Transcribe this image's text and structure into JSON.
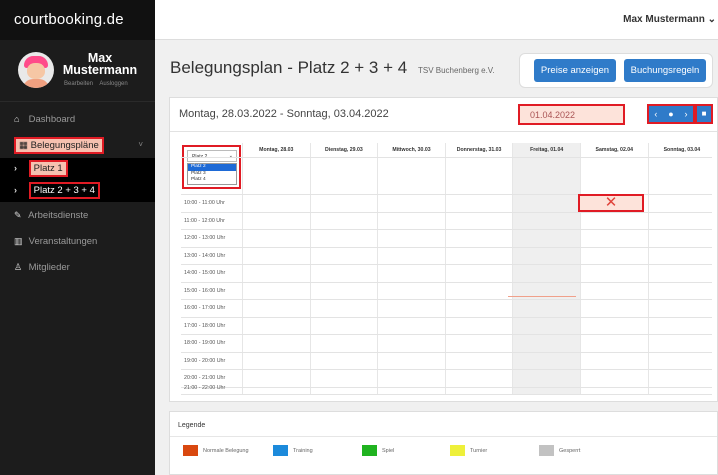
{
  "brand": "courtbooking.de",
  "profile": {
    "name": "Max Mustermann",
    "edit": "Bearbeiten",
    "logout": "Ausloggen"
  },
  "menu": {
    "dashboard": "Dashboard",
    "plans": "Belegungspläne",
    "platz1": "Platz 1",
    "platz234": "Platz 2 + 3 + 4",
    "arbeitsdienste": "Arbeitsdienste",
    "veranstaltungen": "Veranstaltungen",
    "mitglieder": "Mitglieder"
  },
  "user_menu": "Max Mustermann ⌄",
  "page": {
    "title": "Belegungsplan - Platz 2 + 3 + 4",
    "club": "TSV Buchenberg e.V."
  },
  "buttons": {
    "prices": "Preise anzeigen",
    "rules": "Buchungsregeln"
  },
  "week": {
    "range": "Montag, 28.03.2022 - Sonntag, 03.04.2022",
    "date_input": "01.04.2022"
  },
  "court_select": {
    "value": "Platz 2",
    "options": [
      "Platz 2",
      "Platz 3",
      "Platz 4"
    ]
  },
  "days": [
    "Montag, 28.03",
    "Dienstag, 29.03",
    "Mittwoch, 30.03",
    "Donnerstag, 31.03",
    "Freitag, 01.04",
    "Samstag, 02.04",
    "Sonntag, 03.04"
  ],
  "times": [
    "10:00 - 11:00 Uhr",
    "11:00 - 12:00 Uhr",
    "12:00 - 13:00 Uhr",
    "13:00 - 14:00 Uhr",
    "14:00 - 15:00 Uhr",
    "15:00 - 16:00 Uhr",
    "16:00 - 17:00 Uhr",
    "17:00 - 18:00 Uhr",
    "18:00 - 19:00 Uhr",
    "19:00 - 20:00 Uhr",
    "20:00 - 21:00 Uhr",
    "21:00 - 22:00 Uhr"
  ],
  "legend": {
    "title": "Legende",
    "items": [
      {
        "label": "Normale Belegung",
        "color": "#d9480f"
      },
      {
        "label": "Training",
        "color": "#1c8adb"
      },
      {
        "label": "Spiel",
        "color": "#20b320"
      },
      {
        "label": "Turnier",
        "color": "#eef03a"
      },
      {
        "label": "Gesperrt",
        "color": "#c2c2c2"
      }
    ]
  }
}
